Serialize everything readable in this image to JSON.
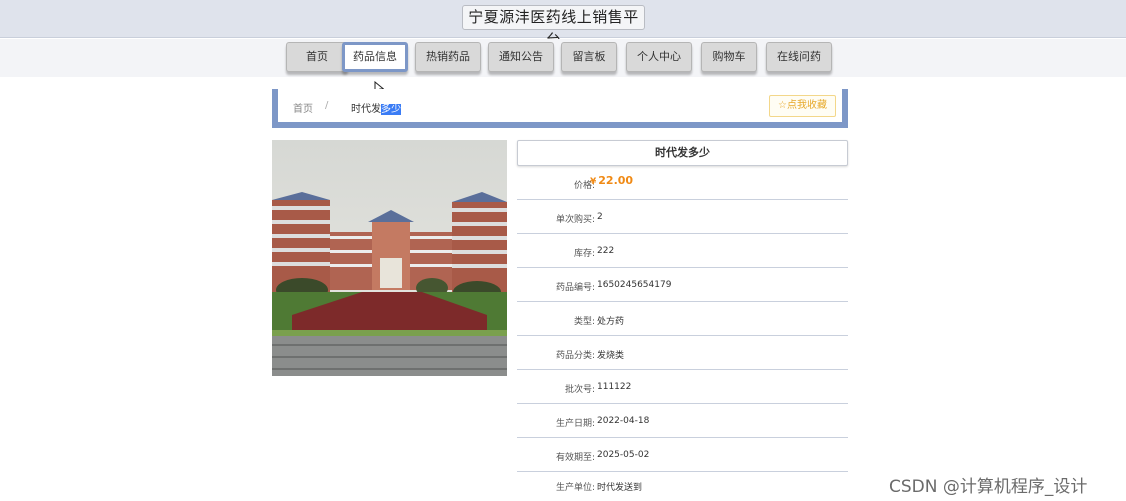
{
  "header": {
    "title": "宁夏源沣医药线上销售平台"
  },
  "nav": {
    "items": [
      {
        "label": "首页"
      },
      {
        "label": "药品信息"
      },
      {
        "label": "热销药品"
      },
      {
        "label": "通知公告"
      },
      {
        "label": "留言板"
      },
      {
        "label": "个人中心"
      },
      {
        "label": "购物车"
      },
      {
        "label": "在线问药"
      }
    ],
    "active": "药品信息"
  },
  "breadcrumb": {
    "home": "首页",
    "separator": "/",
    "current_prefix": "时代发",
    "current_selected": "多少"
  },
  "favorite": {
    "label": "☆点我收藏"
  },
  "product": {
    "name": "时代发多少",
    "price_label": "价格:",
    "currency": "¥",
    "price": "22.00",
    "details": [
      {
        "label": "单次购买:",
        "value": "2"
      },
      {
        "label": "库存:",
        "value": "222"
      },
      {
        "label": "药品编号:",
        "value": "1650245654179"
      },
      {
        "label": "类型:",
        "value": "处方药"
      },
      {
        "label": "药品分类:",
        "value": "发烧类"
      },
      {
        "label": "批次号:",
        "value": "111122"
      },
      {
        "label": "生产日期:",
        "value": "2022-04-18"
      },
      {
        "label": "有效期至:",
        "value": "2025-05-02"
      },
      {
        "label": "生产单位:",
        "value": "时代发送到"
      }
    ]
  },
  "watermark": "CSDN @计算机程序_设计",
  "colors": {
    "accent": "#7d97c7",
    "price": "#f08a15",
    "favorite": "#e7a92a",
    "selection": "#3a7cf5"
  }
}
